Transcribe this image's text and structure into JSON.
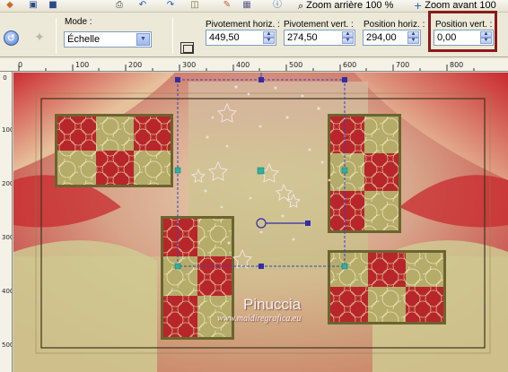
{
  "toolbar": {
    "icons": [
      "palette-icon",
      "window-icon",
      "maximize-icon",
      "print-icon",
      "undo-icon",
      "redo-icon",
      "layers-icon",
      "tool-icon",
      "materials-icon",
      "info-icon",
      "zoom-out-icon",
      "zoom-in-icon"
    ],
    "zoom_out_label": "Zoom arrière 100 %",
    "zoom_in_label": "Zoom avant 100"
  },
  "props": {
    "mode_label": "Mode :",
    "mode_value": "Échelle",
    "pivot_h_label": "Pivotement horiz. :",
    "pivot_h_value": "449,50",
    "pivot_v_label": "Pivotement vert. :",
    "pivot_v_value": "274,50",
    "pos_h_label": "Position horiz. :",
    "pos_h_value": "294,00",
    "pos_v_label": "Position vert. :",
    "pos_v_value": "0,00"
  },
  "ruler": {
    "h_ticks": [
      "0",
      "100",
      "200",
      "300",
      "400",
      "500",
      "600",
      "700",
      "800"
    ],
    "v_ticks": [
      "0",
      "100",
      "200",
      "300",
      "400",
      "500"
    ]
  },
  "watermark": {
    "title": "Pinuccia",
    "url": "www.maidiregrafica.eu"
  },
  "colors": {
    "accent_highlight": "#8b1a1a",
    "canvas_red": "#c82a2e",
    "canvas_khaki": "#cfca92",
    "selection_blue": "#3a3ec8",
    "handle_teal": "#2bb3a3"
  }
}
